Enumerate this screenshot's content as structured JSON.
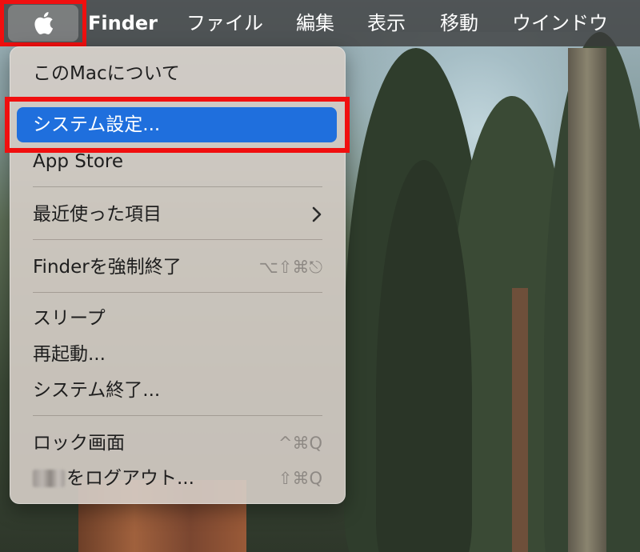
{
  "menubar": {
    "apple_icon": "apple-logo",
    "app_name": "Finder",
    "items": [
      "ファイル",
      "編集",
      "表示",
      "移動",
      "ウインドウ"
    ]
  },
  "apple_menu": {
    "about": "このMacについて",
    "system_settings": "システム設定...",
    "app_store": "App Store",
    "recent_items": "最近使った項目",
    "force_quit": "Finderを強制終了",
    "force_quit_shortcut": "⌥⇧⌘⎋",
    "sleep": "スリープ",
    "restart": "再起動...",
    "shutdown": "システム終了...",
    "lock_screen": "ロック画面",
    "lock_screen_shortcut": "^⌘Q",
    "logout": "をログアウト...",
    "logout_shortcut": "⇧⌘Q"
  },
  "colors": {
    "selection": "#1f6fdd",
    "annotation_highlight": "#f00f0f"
  }
}
